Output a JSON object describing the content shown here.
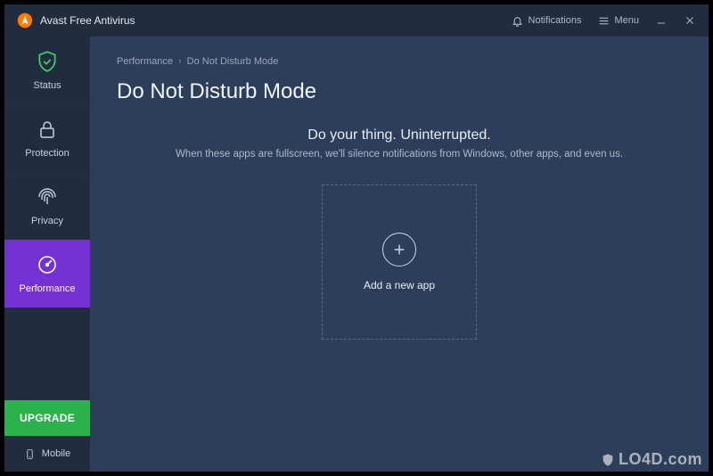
{
  "titlebar": {
    "app_name": "Avast Free Antivirus",
    "notifications_label": "Notifications",
    "menu_label": "Menu"
  },
  "sidebar": {
    "items": [
      {
        "label": "Status"
      },
      {
        "label": "Protection"
      },
      {
        "label": "Privacy"
      },
      {
        "label": "Performance"
      }
    ],
    "upgrade_label": "UPGRADE",
    "mobile_label": "Mobile"
  },
  "breadcrumb": {
    "parent": "Performance",
    "current": "Do Not Disturb Mode"
  },
  "page": {
    "title": "Do Not Disturb Mode",
    "heading": "Do your thing. Uninterrupted.",
    "description": "When these apps are fullscreen, we'll silence notifications from Windows, other apps, and even us."
  },
  "add_card": {
    "label": "Add a new app"
  },
  "colors": {
    "accent": "#7431d4",
    "sidebar_bg": "#222c3f",
    "main_bg": "#2c3e5a",
    "upgrade": "#2bb24c",
    "logo": "#ff7800"
  },
  "watermark": "LO4D.com"
}
